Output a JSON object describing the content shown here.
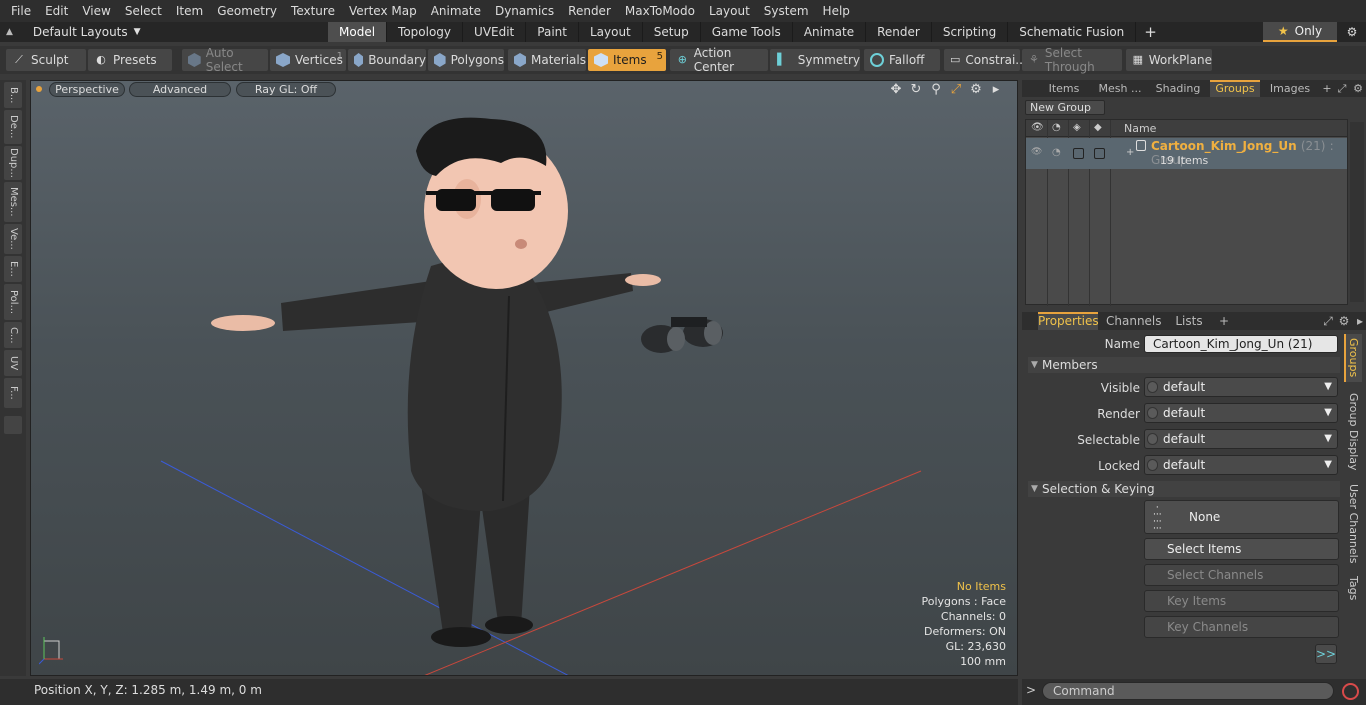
{
  "menu": [
    "File",
    "Edit",
    "View",
    "Select",
    "Item",
    "Geometry",
    "Texture",
    "Vertex Map",
    "Animate",
    "Dynamics",
    "Render",
    "MaxToModo",
    "Layout",
    "System",
    "Help"
  ],
  "layout": {
    "dropdown": "Default Layouts",
    "tabs": [
      "Model",
      "Topology",
      "UVEdit",
      "Paint",
      "Layout",
      "Setup",
      "Game Tools",
      "Animate",
      "Render",
      "Scripting",
      "Schematic Fusion"
    ],
    "active_tab": "Model",
    "only_label": "Only"
  },
  "toolbar": {
    "sculpt": "Sculpt",
    "presets": "Presets",
    "auto_select": "Auto Select",
    "vertices": "Vertices",
    "vertices_count": "1",
    "boundary": "Boundary",
    "polygons": "Polygons",
    "materials": "Materials",
    "items": "Items",
    "items_count": "5",
    "action_center": "Action Center",
    "symmetry": "Symmetry",
    "falloff": "Falloff",
    "constraints": "Constrai...",
    "select_through": "Select Through",
    "workplane": "WorkPlane"
  },
  "left_tabs": [
    "B...",
    "De...",
    "Dup...",
    "Mes...",
    "Ve...",
    "E...",
    "Pol...",
    "C...",
    "UV",
    "F..."
  ],
  "viewport": {
    "perspective": "Perspective",
    "advanced": "Advanced",
    "raygl": "Ray GL: Off",
    "info": {
      "no_items": "No Items",
      "polygons": "Polygons : Face",
      "channels": "Channels: 0",
      "deformers": "Deformers: ON",
      "gl": "GL: 23,630",
      "scale": "100 mm"
    }
  },
  "top_panel": {
    "tabs": [
      "Items",
      "Mesh ...",
      "Shading",
      "Groups",
      "Images"
    ],
    "active": "Groups",
    "new_group": "New Group",
    "col_name": "Name",
    "group": {
      "name": "Cartoon_Kim_Jong_Un",
      "count": "(21)",
      "type": ": Group",
      "sub": "19 Items"
    }
  },
  "properties": {
    "tabs": [
      "Properties",
      "Channels",
      "Lists"
    ],
    "name_label": "Name",
    "name_value": "Cartoon_Kim_Jong_Un (21)",
    "members": "Members",
    "visible_label": "Visible",
    "render_label": "Render",
    "selectable_label": "Selectable",
    "locked_label": "Locked",
    "default_val": "default",
    "selection_keying": "Selection & Keying",
    "none": "None",
    "select_items": "Select Items",
    "select_channels": "Select Channels",
    "key_items": "Key Items",
    "key_channels": "Key Channels",
    "more": ">>",
    "side_tabs": [
      "Groups",
      "Group Display",
      "User Channels",
      "Tags"
    ]
  },
  "status": {
    "position": "Position X, Y, Z:   1.285 m, 1.49 m, 0 m"
  },
  "command": {
    "prompt": ">",
    "placeholder": "Command"
  },
  "colors": {
    "accent": "#e8a33d",
    "group_name": "#f0b040"
  }
}
